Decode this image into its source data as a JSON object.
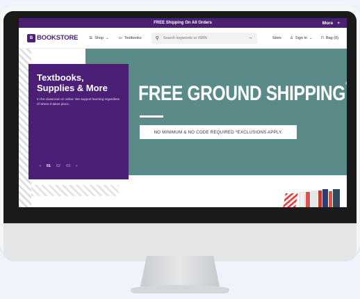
{
  "promo": {
    "text": "FREE Shipping On All Orders",
    "more": "More",
    "plus": "+"
  },
  "header": {
    "logo": "BOOKSTORE",
    "nav": [
      "Shop",
      "Textbooks"
    ],
    "search_placeholder": "Search keywords or ISBN",
    "store": "Store",
    "sign_in": "Sign In",
    "bag": "Bag (0)"
  },
  "hero": {
    "title": "Textbooks, Supplies & More",
    "subtitle": "In the classroom or online. We support learning regardless of where it takes place.",
    "pager": [
      "01",
      "02",
      "03"
    ],
    "headline": "FREE GROUND SHIPPING",
    "headline_mark": "®",
    "note": "NO MINIMUM & NO CODE REQUIRED *EXCLUSIONS APPLY."
  },
  "colors": {
    "brand": "#4a1f75",
    "teal": "#5a8b89"
  }
}
